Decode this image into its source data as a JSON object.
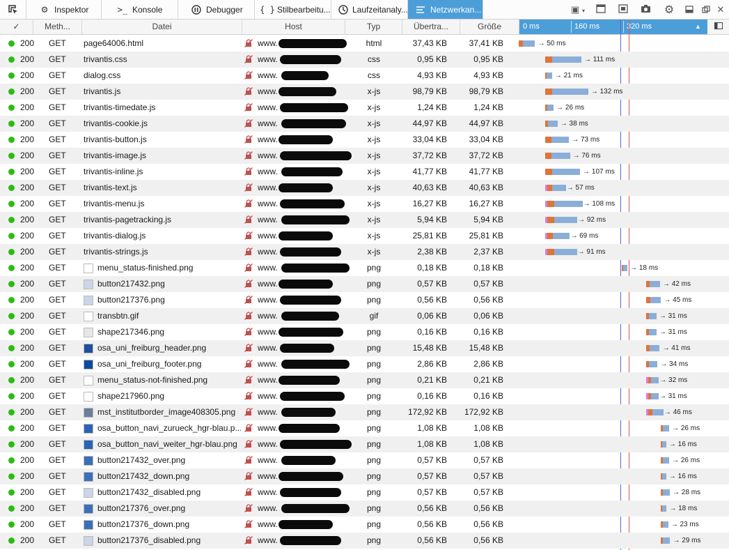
{
  "toolbar": {
    "tabs": [
      {
        "label": "Inspektor",
        "icon": "gear-icon"
      },
      {
        "label": "Konsole",
        "icon": "console-prompt-icon"
      },
      {
        "label": "Debugger",
        "icon": "pause-icon"
      },
      {
        "label": "Stilbearbeitu...",
        "icon": "braces-icon"
      },
      {
        "label": "Laufzeitanaly...",
        "icon": "stopwatch-icon"
      },
      {
        "label": "Netzwerkan...",
        "icon": "network-icon"
      }
    ],
    "selected_tab": "Netzwerkan...",
    "right_icons": [
      "layout-icon",
      "split-console-icon",
      "responsive-icon",
      "screenshot-icon",
      "settings-icon",
      "dock-icon",
      "undock-icon",
      "close-icon"
    ]
  },
  "header": {
    "check": "✓",
    "method": "Meth...",
    "file": "Datei",
    "host": "Host",
    "type": "Typ",
    "transferred": "Übertra...",
    "size": "Größe",
    "wf_labels": [
      "0 ms",
      "160 ms",
      "320 ms"
    ],
    "sort_indicator": "▲"
  },
  "colors": {
    "accent": "#4c9ed9",
    "status_ok": "#2cbb0f",
    "bar_blue": "#8baed8",
    "bar_orange": "#e0733a",
    "dom_line": "#4c6bd9",
    "load_line": "#d9534f"
  },
  "rows": [
    {
      "status": "200",
      "method": "GET",
      "file": "page64006.html",
      "host": "www.",
      "type": "html",
      "transferred": "37,43 KB",
      "size": "37,41 KB",
      "time": "→ 50 ms",
      "start": 0,
      "dur": 50
    },
    {
      "status": "200",
      "method": "GET",
      "file": "trivantis.css",
      "host": "www.",
      "type": "css",
      "transferred": "0,95 KB",
      "size": "0,95 KB",
      "time": "→ 111 ms",
      "start": 81,
      "dur": 111
    },
    {
      "status": "200",
      "method": "GET",
      "file": "dialog.css",
      "host": "www.",
      "type": "css",
      "transferred": "4,93 KB",
      "size": "4,93 KB",
      "time": "→ 21 ms",
      "start": 81,
      "dur": 21
    },
    {
      "status": "200",
      "method": "GET",
      "file": "trivantis.js",
      "host": "www.",
      "type": "x-js",
      "transferred": "98,79 KB",
      "size": "98,79 KB",
      "time": "→ 132 ms",
      "start": 81,
      "dur": 132
    },
    {
      "status": "200",
      "method": "GET",
      "file": "trivantis-timedate.js",
      "host": "www.",
      "type": "x-js",
      "transferred": "1,24 KB",
      "size": "1,24 KB",
      "time": "→ 26 ms",
      "start": 81,
      "dur": 26
    },
    {
      "status": "200",
      "method": "GET",
      "file": "trivantis-cookie.js",
      "host": "www.",
      "type": "x-js",
      "transferred": "44,97 KB",
      "size": "44,97 KB",
      "time": "→ 38 ms",
      "start": 81,
      "dur": 38
    },
    {
      "status": "200",
      "method": "GET",
      "file": "trivantis-button.js",
      "host": "www.",
      "type": "x-js",
      "transferred": "33,04 KB",
      "size": "33,04 KB",
      "time": "→ 73 ms",
      "start": 81,
      "dur": 73
    },
    {
      "status": "200",
      "method": "GET",
      "file": "trivantis-image.js",
      "host": "www.",
      "type": "x-js",
      "transferred": "37,72 KB",
      "size": "37,72 KB",
      "time": "→ 76 ms",
      "start": 81,
      "dur": 76
    },
    {
      "status": "200",
      "method": "GET",
      "file": "trivantis-inline.js",
      "host": "www.",
      "type": "x-js",
      "transferred": "41,77 KB",
      "size": "41,77 KB",
      "time": "→ 107 ms",
      "start": 81,
      "dur": 107
    },
    {
      "status": "200",
      "method": "GET",
      "file": "trivantis-text.js",
      "host": "www.",
      "type": "x-js",
      "transferred": "40,63 KB",
      "size": "40,63 KB",
      "time": "→ 57 ms",
      "start": 81,
      "dur": 57
    },
    {
      "status": "200",
      "method": "GET",
      "file": "trivantis-menu.js",
      "host": "www.",
      "type": "x-js",
      "transferred": "16,27 KB",
      "size": "16,27 KB",
      "time": "→ 108 ms",
      "start": 81,
      "dur": 108
    },
    {
      "status": "200",
      "method": "GET",
      "file": "trivantis-pagetracking.js",
      "host": "www.",
      "type": "x-js",
      "transferred": "5,94 KB",
      "size": "5,94 KB",
      "time": "→ 92 ms",
      "start": 81,
      "dur": 92
    },
    {
      "status": "200",
      "method": "GET",
      "file": "trivantis-dialog.js",
      "host": "www.",
      "type": "x-js",
      "transferred": "25,81 KB",
      "size": "25,81 KB",
      "time": "→ 69 ms",
      "start": 81,
      "dur": 69
    },
    {
      "status": "200",
      "method": "GET",
      "file": "trivantis-strings.js",
      "host": "www.",
      "type": "x-js",
      "transferred": "2,38 KB",
      "size": "2,37 KB",
      "time": "→ 91 ms",
      "start": 81,
      "dur": 91
    },
    {
      "status": "200",
      "method": "GET",
      "file": "menu_status-finished.png",
      "host": "www.",
      "type": "png",
      "transferred": "0,18 KB",
      "size": "0,18 KB",
      "time": "→ 18 ms",
      "start": 315,
      "dur": 18,
      "thumb": "#ffffff"
    },
    {
      "status": "200",
      "method": "GET",
      "file": "button217432.png",
      "host": "www.",
      "type": "png",
      "transferred": "0,57 KB",
      "size": "0,57 KB",
      "time": "→ 42 ms",
      "start": 391,
      "dur": 42,
      "thumb": "#c9d6e8"
    },
    {
      "status": "200",
      "method": "GET",
      "file": "button217376.png",
      "host": "www.",
      "type": "png",
      "transferred": "0,56 KB",
      "size": "0,56 KB",
      "time": "→ 45 ms",
      "start": 391,
      "dur": 45,
      "thumb": "#c9d6e8"
    },
    {
      "status": "200",
      "method": "GET",
      "file": "transbtn.gif",
      "host": "www.",
      "type": "gif",
      "transferred": "0,06 KB",
      "size": "0,06 KB",
      "time": "→ 31 ms",
      "start": 391,
      "dur": 31,
      "thumb": "#ffffff"
    },
    {
      "status": "200",
      "method": "GET",
      "file": "shape217346.png",
      "host": "www.",
      "type": "png",
      "transferred": "0,16 KB",
      "size": "0,16 KB",
      "time": "→ 31 ms",
      "start": 391,
      "dur": 31,
      "thumb": "#e6e6e6"
    },
    {
      "status": "200",
      "method": "GET",
      "file": "osa_uni_freiburg_header.png",
      "host": "www.",
      "type": "png",
      "transferred": "15,48 KB",
      "size": "15,48 KB",
      "time": "→ 41 ms",
      "start": 391,
      "dur": 41,
      "thumb": "#1f4f9c"
    },
    {
      "status": "200",
      "method": "GET",
      "file": "osa_uni_freiburg_footer.png",
      "host": "www.",
      "type": "png",
      "transferred": "2,86 KB",
      "size": "2,86 KB",
      "time": "→ 34 ms",
      "start": 391,
      "dur": 34,
      "thumb": "#0e4a9a"
    },
    {
      "status": "200",
      "method": "GET",
      "file": "menu_status-not-finished.png",
      "host": "www.",
      "type": "png",
      "transferred": "0,21 KB",
      "size": "0,21 KB",
      "time": "→ 32 ms",
      "start": 391,
      "dur": 32,
      "thumb": "#ffffff"
    },
    {
      "status": "200",
      "method": "GET",
      "file": "shape217960.png",
      "host": "www.",
      "type": "png",
      "transferred": "0,16 KB",
      "size": "0,16 KB",
      "time": "→ 31 ms",
      "start": 391,
      "dur": 31,
      "thumb": "#ffffff"
    },
    {
      "status": "200",
      "method": "GET",
      "file": "mst_institutborder_image408305.png",
      "host": "www.",
      "type": "png",
      "transferred": "172,92 KB",
      "size": "172,92 KB",
      "time": "→ 46 ms",
      "start": 391,
      "dur": 46,
      "thumb": "#6b7f99"
    },
    {
      "status": "200",
      "method": "GET",
      "file": "osa_button_navi_zurueck_hgr-blau.p...",
      "host": "www.",
      "type": "png",
      "transferred": "1,08 KB",
      "size": "1,08 KB",
      "time": "→ 26 ms",
      "start": 435,
      "dur": 26,
      "thumb": "#2b62b3"
    },
    {
      "status": "200",
      "method": "GET",
      "file": "osa_button_navi_weiter_hgr-blau.png",
      "host": "www.",
      "type": "png",
      "transferred": "1,08 KB",
      "size": "1,08 KB",
      "time": "→ 16 ms",
      "start": 435,
      "dur": 16,
      "thumb": "#2b62b3"
    },
    {
      "status": "200",
      "method": "GET",
      "file": "button217432_over.png",
      "host": "www.",
      "type": "png",
      "transferred": "0,57 KB",
      "size": "0,57 KB",
      "time": "→ 26 ms",
      "start": 435,
      "dur": 26,
      "thumb": "#3d6fb8"
    },
    {
      "status": "200",
      "method": "GET",
      "file": "button217432_down.png",
      "host": "www.",
      "type": "png",
      "transferred": "0,57 KB",
      "size": "0,57 KB",
      "time": "→ 16 ms",
      "start": 435,
      "dur": 16,
      "thumb": "#3d6fb8"
    },
    {
      "status": "200",
      "method": "GET",
      "file": "button217432_disabled.png",
      "host": "www.",
      "type": "png",
      "transferred": "0,57 KB",
      "size": "0,57 KB",
      "time": "→ 28 ms",
      "start": 435,
      "dur": 28,
      "thumb": "#c9d6e8"
    },
    {
      "status": "200",
      "method": "GET",
      "file": "button217376_over.png",
      "host": "www.",
      "type": "png",
      "transferred": "0,56 KB",
      "size": "0,56 KB",
      "time": "→ 18 ms",
      "start": 435,
      "dur": 18,
      "thumb": "#3d6fb8"
    },
    {
      "status": "200",
      "method": "GET",
      "file": "button217376_down.png",
      "host": "www.",
      "type": "png",
      "transferred": "0,56 KB",
      "size": "0,56 KB",
      "time": "→ 23 ms",
      "start": 435,
      "dur": 23,
      "thumb": "#3d6fb8"
    },
    {
      "status": "200",
      "method": "GET",
      "file": "button217376_disabled.png",
      "host": "www.",
      "type": "png",
      "transferred": "0,56 KB",
      "size": "0,56 KB",
      "time": "→ 29 ms",
      "start": 435,
      "dur": 29,
      "thumb": "#c9d6e8"
    }
  ]
}
